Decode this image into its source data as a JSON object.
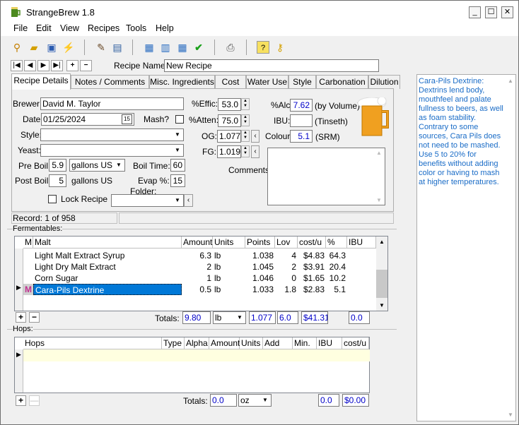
{
  "window": {
    "title": "StrangeBrew 1.8",
    "min": "_",
    "max": "☐",
    "close": "✕"
  },
  "menu": [
    "File",
    "Edit",
    "View",
    "Recipes",
    "Tools",
    "Help"
  ],
  "toolbar": {
    "icons": [
      "search-icon",
      "open-folder-icon",
      "save-icon",
      "wizard-icon",
      "notes-icon",
      "print-preview-icon",
      "calculator-icon",
      "table-icon",
      "grid-icon",
      "check-icon",
      "printer-icon",
      "help-icon",
      "key-icon"
    ]
  },
  "nav": {
    "first": "|◀",
    "prev": "◀",
    "next": "▶",
    "last": "▶|",
    "add": "+",
    "remove": "−"
  },
  "recipe_name": {
    "label": "Recipe Name:",
    "value": "New Recipe"
  },
  "tabs": [
    "Recipe Details",
    "Notes / Comments",
    "Misc. Ingredients",
    "Cost",
    "Water Use",
    "Style",
    "Carbonation",
    "Dilution"
  ],
  "details": {
    "brewer_label": "Brewer:",
    "brewer": "David M. Taylor",
    "date_label": "Date:",
    "date": "01/25/2024",
    "calendar": "15",
    "mash_label": "Mash?",
    "style_label": "Style:",
    "yeast_label": "Yeast:",
    "preboil_label": "Pre Boil:",
    "preboil": "5.9",
    "preboil_units": "gallons US",
    "boiltime_label": "Boil Time:",
    "boiltime": "60",
    "postboil_label": "Post Boil:",
    "postboil": "5",
    "postboil_units": "gallons US",
    "evap_label": "Evap %:",
    "evap": "15",
    "folder_label": "Folder:",
    "lock_label": "Lock Recipe",
    "effic_label": "%Effic:",
    "effic": "53.0",
    "atten_label": "%Atten:",
    "atten": "75.0",
    "og_label": "OG:",
    "og": "1.077",
    "fg_label": "FG:",
    "fg": "1.019",
    "alc_label": "%Alc:",
    "alc": "7.62",
    "alc_unit": "(by Volume)",
    "ibu_label": "IBU:",
    "ibu": "",
    "ibu_unit": "(Tinseth)",
    "colour_label": "Colour:",
    "colour": "5.1",
    "colour_unit": "(SRM)",
    "comments_label": "Comments:"
  },
  "record": "Record: 1 of 958",
  "fermentables": {
    "label": "Fermentables:",
    "headers": [
      "M",
      "Malt",
      "Amount",
      "Units",
      "Points",
      "Lov",
      "cost/u",
      "%",
      "IBU"
    ],
    "rows": [
      {
        "m": "",
        "malt": "Light Malt Extract Syrup",
        "amount": "6.3",
        "units": "lb",
        "points": "1.038",
        "lov": "4",
        "cost": "$4.83",
        "pct": "64.3"
      },
      {
        "m": "",
        "malt": "Light Dry Malt Extract",
        "amount": "2",
        "units": "lb",
        "points": "1.045",
        "lov": "2",
        "cost": "$3.91",
        "pct": "20.4"
      },
      {
        "m": "",
        "malt": "Corn Sugar",
        "amount": "1",
        "units": "lb",
        "points": "1.046",
        "lov": "0",
        "cost": "$1.65",
        "pct": "10.2"
      },
      {
        "m": "M",
        "malt": "Cara-Pils Dextrine",
        "amount": "0.5",
        "units": "lb",
        "points": "1.033",
        "lov": "1.8",
        "cost": "$2.83",
        "pct": "5.1"
      }
    ],
    "totals_label": "Totals:",
    "total_amount": "9.80",
    "total_units": "lb",
    "total_points": "1.077",
    "total_lov": "6.0",
    "total_cost": "$41.31",
    "total_ibu": "0.0"
  },
  "hops": {
    "label": "Hops:",
    "headers": [
      "Hops",
      "Type",
      "Alpha",
      "Amount",
      "Units",
      "Add",
      "Min.",
      "IBU",
      "cost/u"
    ],
    "totals_label": "Totals:",
    "total_amount": "0.0",
    "total_units": "oz",
    "total_ibu": "0.0",
    "total_cost": "$0.00"
  },
  "sidebar_text": "Cara-Pils Dextrine: Dextrins lend body, mouthfeel and palate fullness to beers, as well as foam stability. Contrary to some sources, Cara Pils does not need to be mashed. Use 5 to 20% for benefits without adding color or having to mash at higher temperatures.",
  "colors": {
    "beer": "#f0a020",
    "selected_row": "#0078d7",
    "value_text": "#0000c8",
    "sidebar_text": "#1a6cc7"
  }
}
